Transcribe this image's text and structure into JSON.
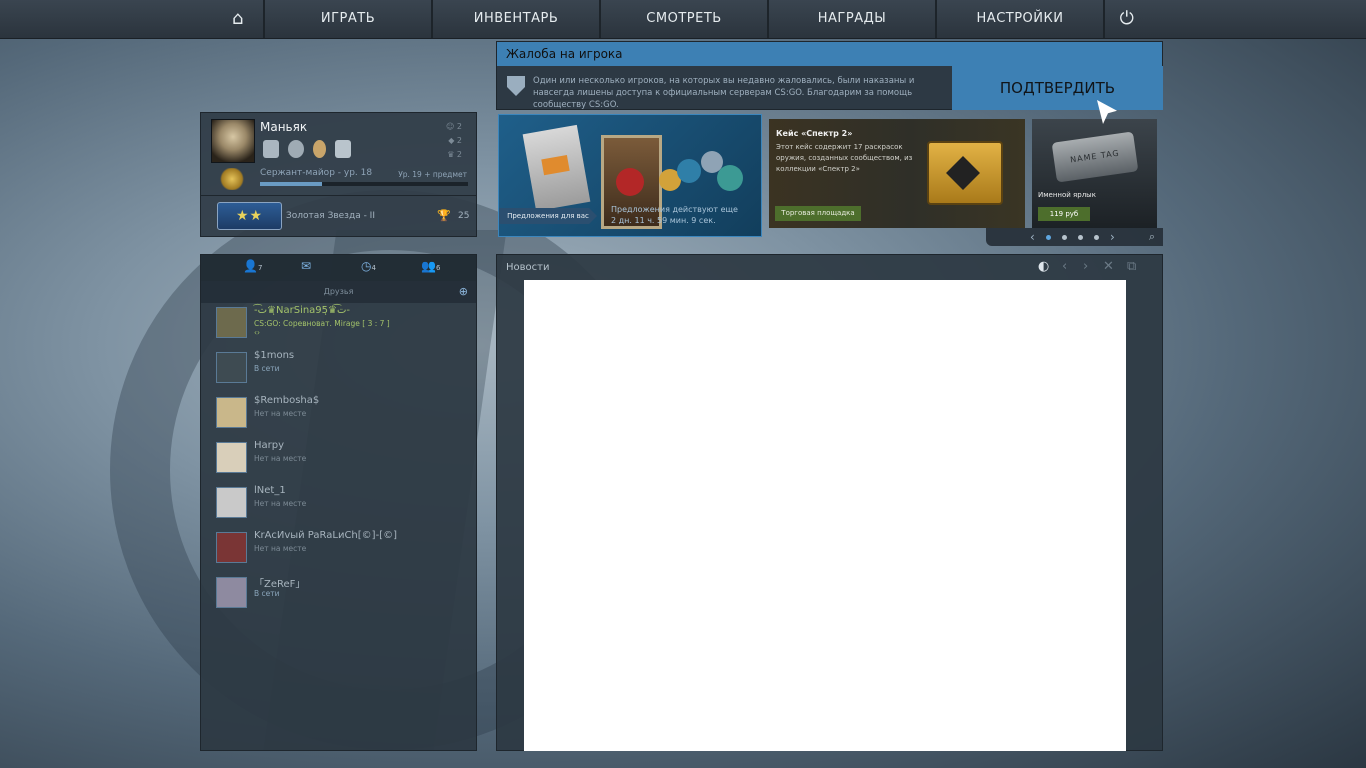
{
  "nav": {
    "home_icon": "home-icon",
    "items": [
      {
        "label": "ИГРАТЬ"
      },
      {
        "label": "ИНВЕНТАРЬ"
      },
      {
        "label": "СМОТРЕТЬ"
      },
      {
        "label": "НАГРАДЫ"
      },
      {
        "label": "НАСТРОЙКИ"
      }
    ],
    "power_icon": "power-icon"
  },
  "report": {
    "title": "Жалоба на игрока",
    "text": "Один или несколько игроков, на которых вы недавно жаловались, были наказаны и навсегда лишены доступа к официальным серверам CS:GO. Благодарим за помощь сообществу CS:GO.",
    "confirm_label": "ПОДТВЕРДИТЬ"
  },
  "profile": {
    "name": "Маньяк",
    "rank_title": "Сержант-майор - ур. 18",
    "level_note": "Ур. 19 + предмет",
    "xp_progress": 0.3,
    "side_counts": [
      "2",
      "2",
      "2"
    ],
    "competitive_rank": "Золотая Звезда - II",
    "rank_badge": "★★",
    "trophies": "25"
  },
  "store": {
    "offer_tag": "Предложения для вас",
    "offer_line1": "Предложения действуют еще",
    "offer_line2": "2 дн. 11 ч. 59 мин. 9 сек.",
    "case_title": "Кейс «Спектр 2»",
    "case_desc": "Этот кейс содержит 17 раскрасок оружия, созданных сообществом, из коллекции «Спектр 2»",
    "market_label": "Торговая площадка",
    "nametag_text": "NAME TAG",
    "nametag_label": "Именной ярлык",
    "nametag_price": "119 руб",
    "pager_dots": 4,
    "active_dot": 0
  },
  "friends": {
    "tabs": [
      {
        "icon": "person-icon",
        "count": "7"
      },
      {
        "icon": "mail-icon",
        "count": ""
      },
      {
        "icon": "history-icon",
        "count": "4"
      },
      {
        "icon": "group-icon",
        "count": "6"
      }
    ],
    "section_label": "Друзья",
    "list": [
      {
        "name": "-ت͡♛ͅNarSina95ͅ♛͡ت-",
        "status": "CS:GO: Соревноват. Mirage [ 3 : 7 ]",
        "extra": "‹›",
        "state": "ingame",
        "color": "#6d6a4d"
      },
      {
        "name": "$1mons",
        "status": "В сети",
        "state": "online",
        "color": "#3e4b52"
      },
      {
        "name": "$Rembosha$",
        "status": "Нет на месте",
        "state": "away",
        "color": "#c9b78a"
      },
      {
        "name": "Harpy",
        "status": "Нет на месте",
        "state": "away",
        "color": "#d9cfba"
      },
      {
        "name": "lNet_1",
        "status": "Нет на месте",
        "state": "away",
        "color": "#c9c9c9"
      },
      {
        "name": "KrAcИvый PaRaLиCh[©]-[©]",
        "status": "Нет на месте",
        "state": "away",
        "color": "#7a3535"
      },
      {
        "name": "「ZeReF」",
        "status": "В сети",
        "state": "online",
        "color": "#8e8aa0"
      }
    ]
  },
  "news": {
    "title": "Новости"
  }
}
